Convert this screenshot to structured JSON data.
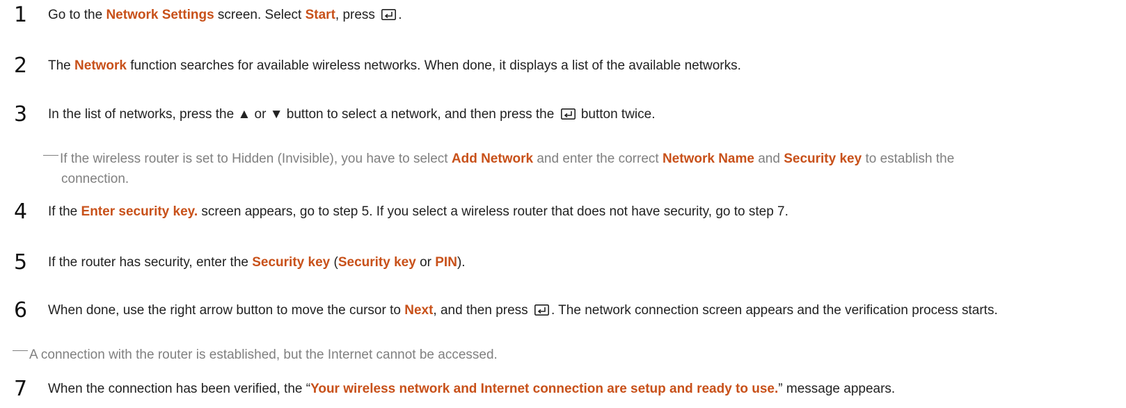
{
  "steps": [
    {
      "number": "1",
      "p1": "Go to the ",
      "b1": "Network Settings",
      "p2": " screen. Select ",
      "b2": "Start",
      "p3": ", press ",
      "p4": "."
    },
    {
      "number": "2",
      "p1": "The ",
      "b1": "Network",
      "p2": " function searches for available wireless networks. When done, it displays a list of the available networks."
    },
    {
      "number": "3",
      "p1": "In the list of networks, press the ▲ or ▼ button to select a network, and then press the ",
      "p2": " button twice."
    },
    {
      "number": "4",
      "p1": "If the ",
      "b1": "Enter security key.",
      "p2": " screen appears, go to step 5. If you select a wireless router that does not have security, go to step 7."
    },
    {
      "number": "5",
      "p1": "If the router has security, enter the ",
      "b1": "Security key",
      "p2": " (",
      "b2": "Security key",
      "p3": " or ",
      "b3": "PIN",
      "p4": ")."
    },
    {
      "number": "6",
      "p1": "When done, use the right arrow button to move the cursor to ",
      "b1": "Next",
      "p2": ", and then press ",
      "p3": ". The network connection screen appears and the verification process starts."
    },
    {
      "number": "7",
      "p1": "When the connection has been verified, the “",
      "b1": "Your wireless network and Internet connection are setup and ready to use.",
      "p2": "” message appears."
    }
  ],
  "notes": {
    "hidden_router": {
      "p1": "If the wireless router is set to Hidden (Invisible), you have to select ",
      "b1": "Add Network",
      "p2": " and enter the correct ",
      "b2": "Network Name",
      "p3": " and ",
      "b3": "Security key",
      "p4": " to establish the",
      "line2": "connection."
    },
    "no_internet": {
      "text": "A connection with the router is established, but the Internet cannot be accessed."
    }
  },
  "icons": {
    "enter": "enter-key-icon"
  },
  "colors": {
    "highlight": "#c8511a",
    "note_text": "#808080",
    "body_text": "#222222"
  }
}
